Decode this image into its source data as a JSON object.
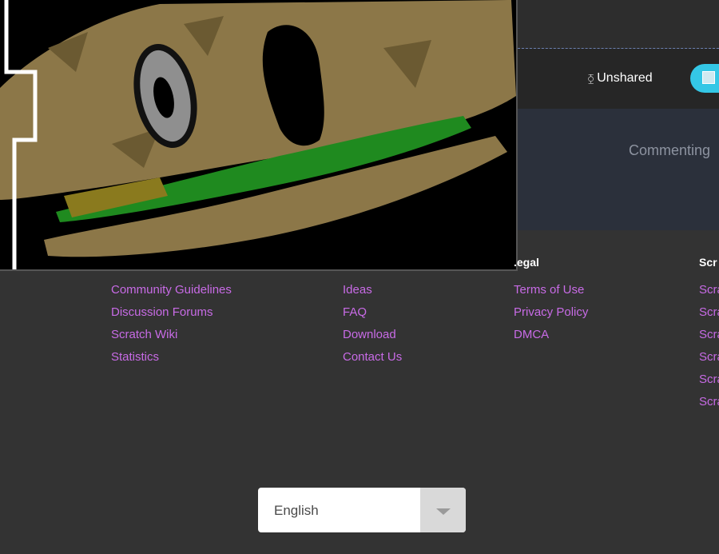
{
  "project": {
    "share_status": "Unshared",
    "share_status_icon": "unshared-icon",
    "commenting_text": "Commenting"
  },
  "footer": {
    "columns": [
      {
        "title": "",
        "links": [
          "Community Guidelines",
          "Discussion Forums",
          "Scratch Wiki",
          "Statistics"
        ]
      },
      {
        "title": "",
        "links": [
          "Ideas",
          "FAQ",
          "Download",
          "Contact Us"
        ]
      },
      {
        "title": ".egal",
        "links": [
          "Terms of Use",
          "Privacy Policy",
          "DMCA"
        ]
      },
      {
        "title": "Scr",
        "links": [
          "Scra",
          "Scra",
          "Scra",
          "Scra",
          "Scra",
          "Scra"
        ]
      }
    ]
  },
  "language": {
    "selected": "English"
  },
  "colors": {
    "background": "#333333",
    "link": "#c86be6",
    "share_button": "#34c7e6"
  }
}
